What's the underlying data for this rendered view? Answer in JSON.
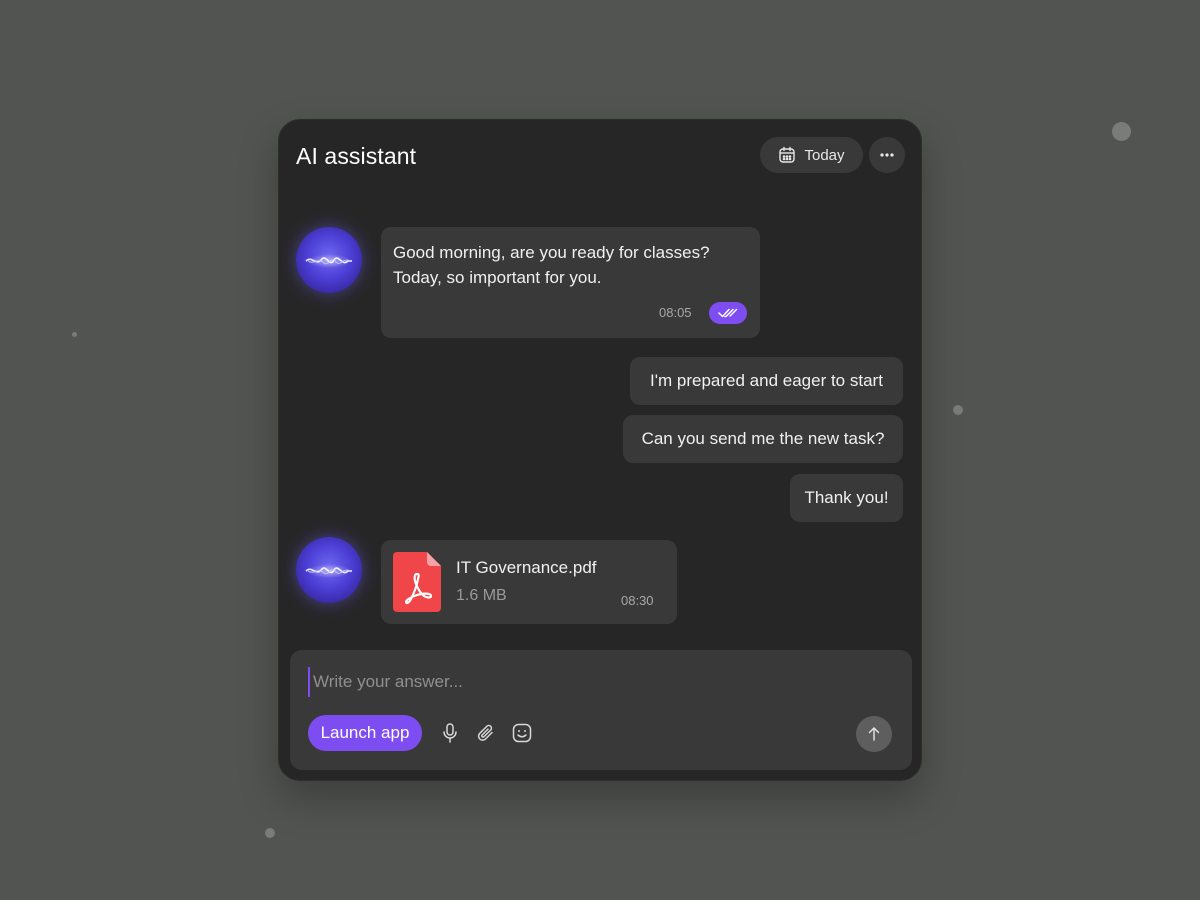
{
  "header": {
    "title": "AI assistant",
    "today_label": "Today"
  },
  "messages": [
    {
      "sender": "assistant",
      "text_line1": "Good morning, are you ready for classes?",
      "text_line2": "Today, so important for you.",
      "time": "08:05",
      "read": true
    },
    {
      "sender": "user",
      "text": "I'm prepared and eager to start"
    },
    {
      "sender": "user",
      "text": "Can you send me the new task?"
    },
    {
      "sender": "user",
      "text": "Thank you!"
    },
    {
      "sender": "assistant",
      "attachment": {
        "file_name": "IT Governance.pdf",
        "file_size": "1.6 MB",
        "type_icon": "pdf-icon"
      },
      "time": "08:30"
    }
  ],
  "composer": {
    "placeholder": "Write your answer...",
    "value": "",
    "launch_label": "Launch app",
    "tools": [
      "microphone-icon",
      "paperclip-icon",
      "emoji-icon"
    ],
    "send_icon": "arrow-up-icon"
  },
  "colors": {
    "background": "#525451",
    "panel": "#272627",
    "bubble": "#3a393a",
    "accent": "#7e4df2",
    "pdf_red": "#f0464a"
  }
}
